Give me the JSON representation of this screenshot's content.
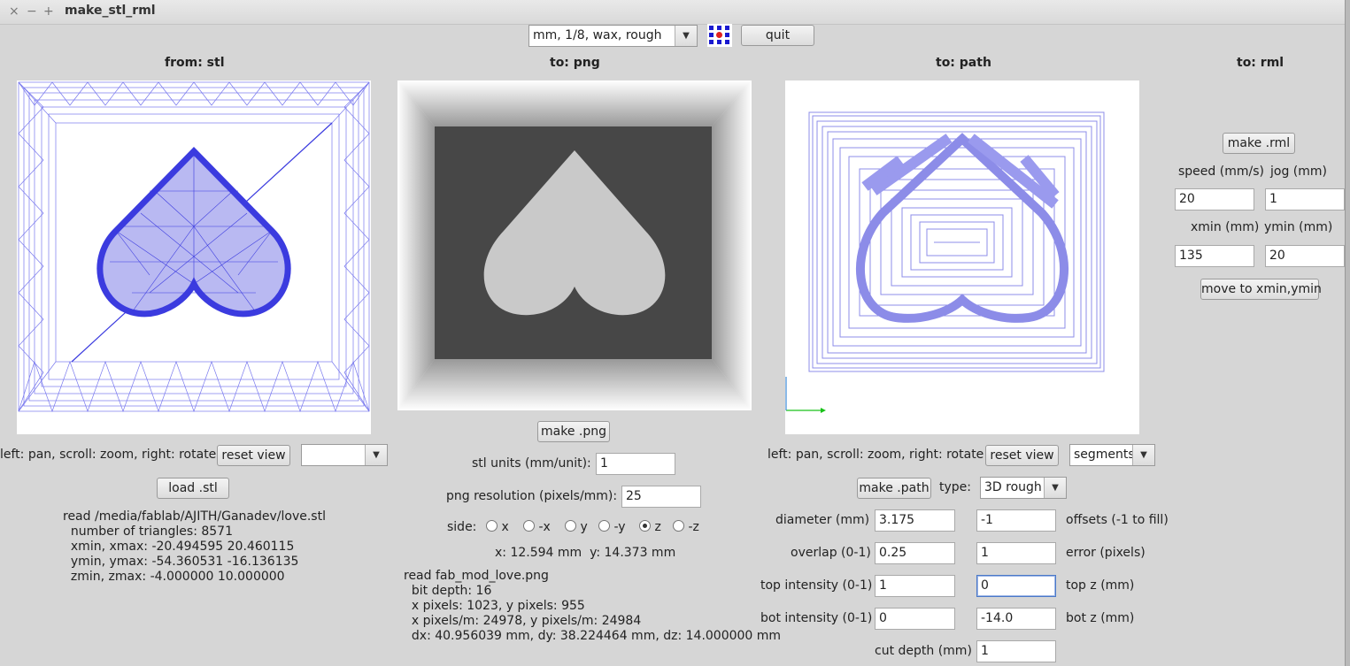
{
  "window": {
    "title": "make_stl_rml",
    "controls": [
      "×",
      "−",
      "+"
    ]
  },
  "toolbar": {
    "preset_value": "mm, 1/8, wax, rough",
    "quit_label": "quit"
  },
  "stl_panel": {
    "header": "from: stl",
    "hint": "left: pan, scroll: zoom, right: rotate",
    "reset_view_label": "reset view",
    "view_select_value": "",
    "load_label": "load .stl",
    "info_lines": [
      "read /media/fablab/AJITH/Ganadev/love.stl",
      "  number of triangles: 8571",
      "  xmin, xmax: -20.494595 20.460115",
      "  ymin, ymax: -54.360531 -16.136135",
      "  zmin, zmax: -4.000000 10.000000"
    ]
  },
  "png_panel": {
    "header": "to: png",
    "make_label": "make .png",
    "units_label": "stl units (mm/unit):",
    "units_value": "1",
    "resolution_label": "png resolution (pixels/mm):",
    "resolution_value": "25",
    "side_label": "side:",
    "sides": [
      {
        "label": "x",
        "selected": false
      },
      {
        "label": "-x",
        "selected": false
      },
      {
        "label": "y",
        "selected": false
      },
      {
        "label": "-y",
        "selected": false
      },
      {
        "label": "z",
        "selected": true
      },
      {
        "label": "-z",
        "selected": false
      }
    ],
    "size_text": "x: 12.594 mm  y: 14.373 mm",
    "info_lines": [
      "read fab_mod_love.png",
      "  bit depth: 16",
      "  x pixels: 1023, y pixels: 955",
      "  x pixels/m: 24978, y pixels/m: 24984",
      "  dx: 40.956039 mm, dy: 38.224464 mm, dz: 14.000000 mm"
    ]
  },
  "path_panel": {
    "header": "to: path",
    "hint": "left: pan, scroll: zoom, right: rotate",
    "reset_view_label": "reset view",
    "view_select_value": "segments",
    "make_label": "make .path",
    "type_label": "type:",
    "type_value": "3D rough",
    "diameter_label": "diameter (mm)",
    "diameter_value": "3.175",
    "offsets_value": "-1",
    "offsets_label": "offsets (-1 to fill)",
    "overlap_label": "overlap (0-1)",
    "overlap_value": "0.25",
    "error_value": "1",
    "error_label": "error (pixels)",
    "top_intensity_label": "top intensity (0-1)",
    "top_intensity_value": "1",
    "top_z_value": "0",
    "top_z_label": "top z (mm)",
    "bot_intensity_label": "bot intensity (0-1)",
    "bot_intensity_value": "0",
    "bot_z_value": "-14.0",
    "bot_z_label": "bot z (mm)",
    "cut_depth_label": "cut depth (mm)",
    "cut_depth_value": "1"
  },
  "rml_panel": {
    "header": "to: rml",
    "make_label": "make .rml",
    "speed_label": "speed (mm/s)",
    "speed_value": "20",
    "jog_label": "jog (mm)",
    "jog_value": "1",
    "xmin_label": "xmin (mm)",
    "xmin_value": "135",
    "ymin_label": "ymin (mm)",
    "ymin_value": "20",
    "move_label": "move to xmin,ymin"
  },
  "colors": {
    "mesh_blue": "#3b3bdf",
    "path_blue": "#8c8ce8",
    "png_dark": "#474747",
    "png_heart": "#c9c9c9",
    "axis_green": "#19c219",
    "focus_border": "#4a78c8"
  }
}
